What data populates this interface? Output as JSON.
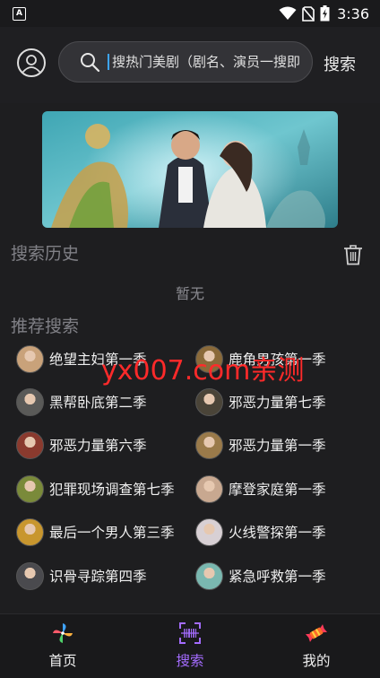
{
  "status_bar": {
    "time": "3:36",
    "app_badge": "A"
  },
  "header": {
    "search_placeholder": "搜热门美剧（剧名、演员一搜即",
    "search_button": "搜索"
  },
  "history": {
    "title": "搜索历史",
    "empty_text": "暂无"
  },
  "recommend": {
    "title": "推荐搜索",
    "items": [
      {
        "label": "绝望主妇第一季",
        "thumb_color": "#c9a27a"
      },
      {
        "label": "鹿角男孩第一季",
        "thumb_color": "#8a6a3a"
      },
      {
        "label": "黑帮卧底第二季",
        "thumb_color": "#5a5a58"
      },
      {
        "label": "邪恶力量第七季",
        "thumb_color": "#4a4438"
      },
      {
        "label": "邪恶力量第六季",
        "thumb_color": "#8a3a2e"
      },
      {
        "label": "邪恶力量第一季",
        "thumb_color": "#9a7a4a"
      },
      {
        "label": "犯罪现场调查第七季",
        "thumb_color": "#7a8a3a"
      },
      {
        "label": "摩登家庭第一季",
        "thumb_color": "#c8a890"
      },
      {
        "label": "最后一个男人第三季",
        "thumb_color": "#c8962e"
      },
      {
        "label": "火线警探第一季",
        "thumb_color": "#d8d0d4"
      },
      {
        "label": "识骨寻踪第四季",
        "thumb_color": "#4a4a4e"
      },
      {
        "label": "紧急呼救第一季",
        "thumb_color": "#7ab8b0"
      }
    ]
  },
  "watermark": "yx007.com亲测",
  "bottom_nav": {
    "items": [
      {
        "label": "首页",
        "icon": "pinwheel-icon",
        "active": false
      },
      {
        "label": "搜索",
        "icon": "barcode-scan-icon",
        "active": true
      },
      {
        "label": "我的",
        "icon": "candy-icon",
        "active": false
      }
    ]
  },
  "colors": {
    "background": "#1e1e20",
    "accent_active": "#a46cff",
    "watermark": "#ff2a2a"
  }
}
